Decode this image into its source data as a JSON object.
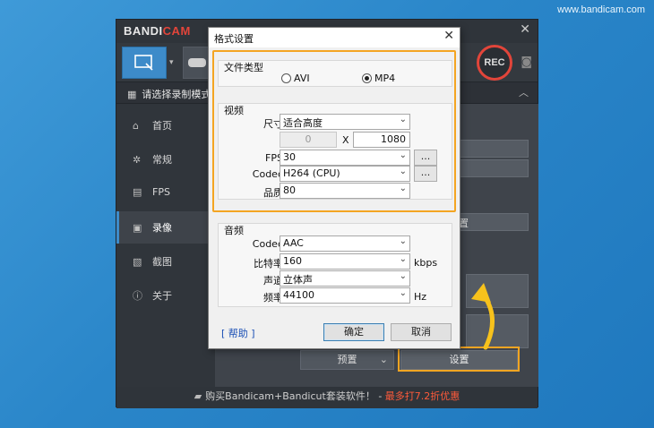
{
  "watermark": "www.bandicam.com",
  "bandicam": {
    "logo_main": "BANDI",
    "logo_accent": "CAM",
    "rec_label": "REC",
    "mode_label": "请选择录制模式",
    "sidebar": [
      {
        "label": "首页",
        "icon": "home-icon"
      },
      {
        "label": "常规",
        "icon": "gear-icon"
      },
      {
        "label": "FPS",
        "icon": "fps-icon"
      },
      {
        "label": "录像",
        "icon": "video-icon"
      },
      {
        "label": "截图",
        "icon": "image-icon"
      },
      {
        "label": "关于",
        "icon": "info-icon"
      }
    ],
    "preset_label": "预置",
    "settings_label": "设置",
    "ghost_text": "置",
    "footer_text": "购买Bandicam+Bandicut套装软件！ - ",
    "footer_promo": "最多打7.2折优惠"
  },
  "dialog": {
    "title": "格式设置",
    "file_type": {
      "group_label": "文件类型",
      "options": [
        "AVI",
        "MP4"
      ],
      "selected": "MP4"
    },
    "video": {
      "group_label": "视频",
      "size_label": "尺寸",
      "size_value": "适合高度",
      "width_value": "0",
      "x_label": "X",
      "height_value": "1080",
      "fps_label": "FPS",
      "fps_value": "30",
      "codec_label": "Codec",
      "codec_value": "H264 (CPU)",
      "quality_label": "品质",
      "quality_value": "80",
      "more_label": "..."
    },
    "audio": {
      "group_label": "音频",
      "codec_label": "Codec",
      "codec_value": "AAC",
      "bitrate_label": "比特率",
      "bitrate_value": "160",
      "bitrate_unit": "kbps",
      "channel_label": "声道",
      "channel_value": "立体声",
      "freq_label": "频率",
      "freq_value": "44100",
      "freq_unit": "Hz"
    },
    "help_label": "[ 帮助 ]",
    "ok_label": "确定",
    "cancel_label": "取消"
  },
  "colors": {
    "highlight": "#f4a522",
    "accent_blue": "#3d8bc9",
    "rec_red": "#e2453a",
    "arrow_yellow": "#f7c21c"
  }
}
